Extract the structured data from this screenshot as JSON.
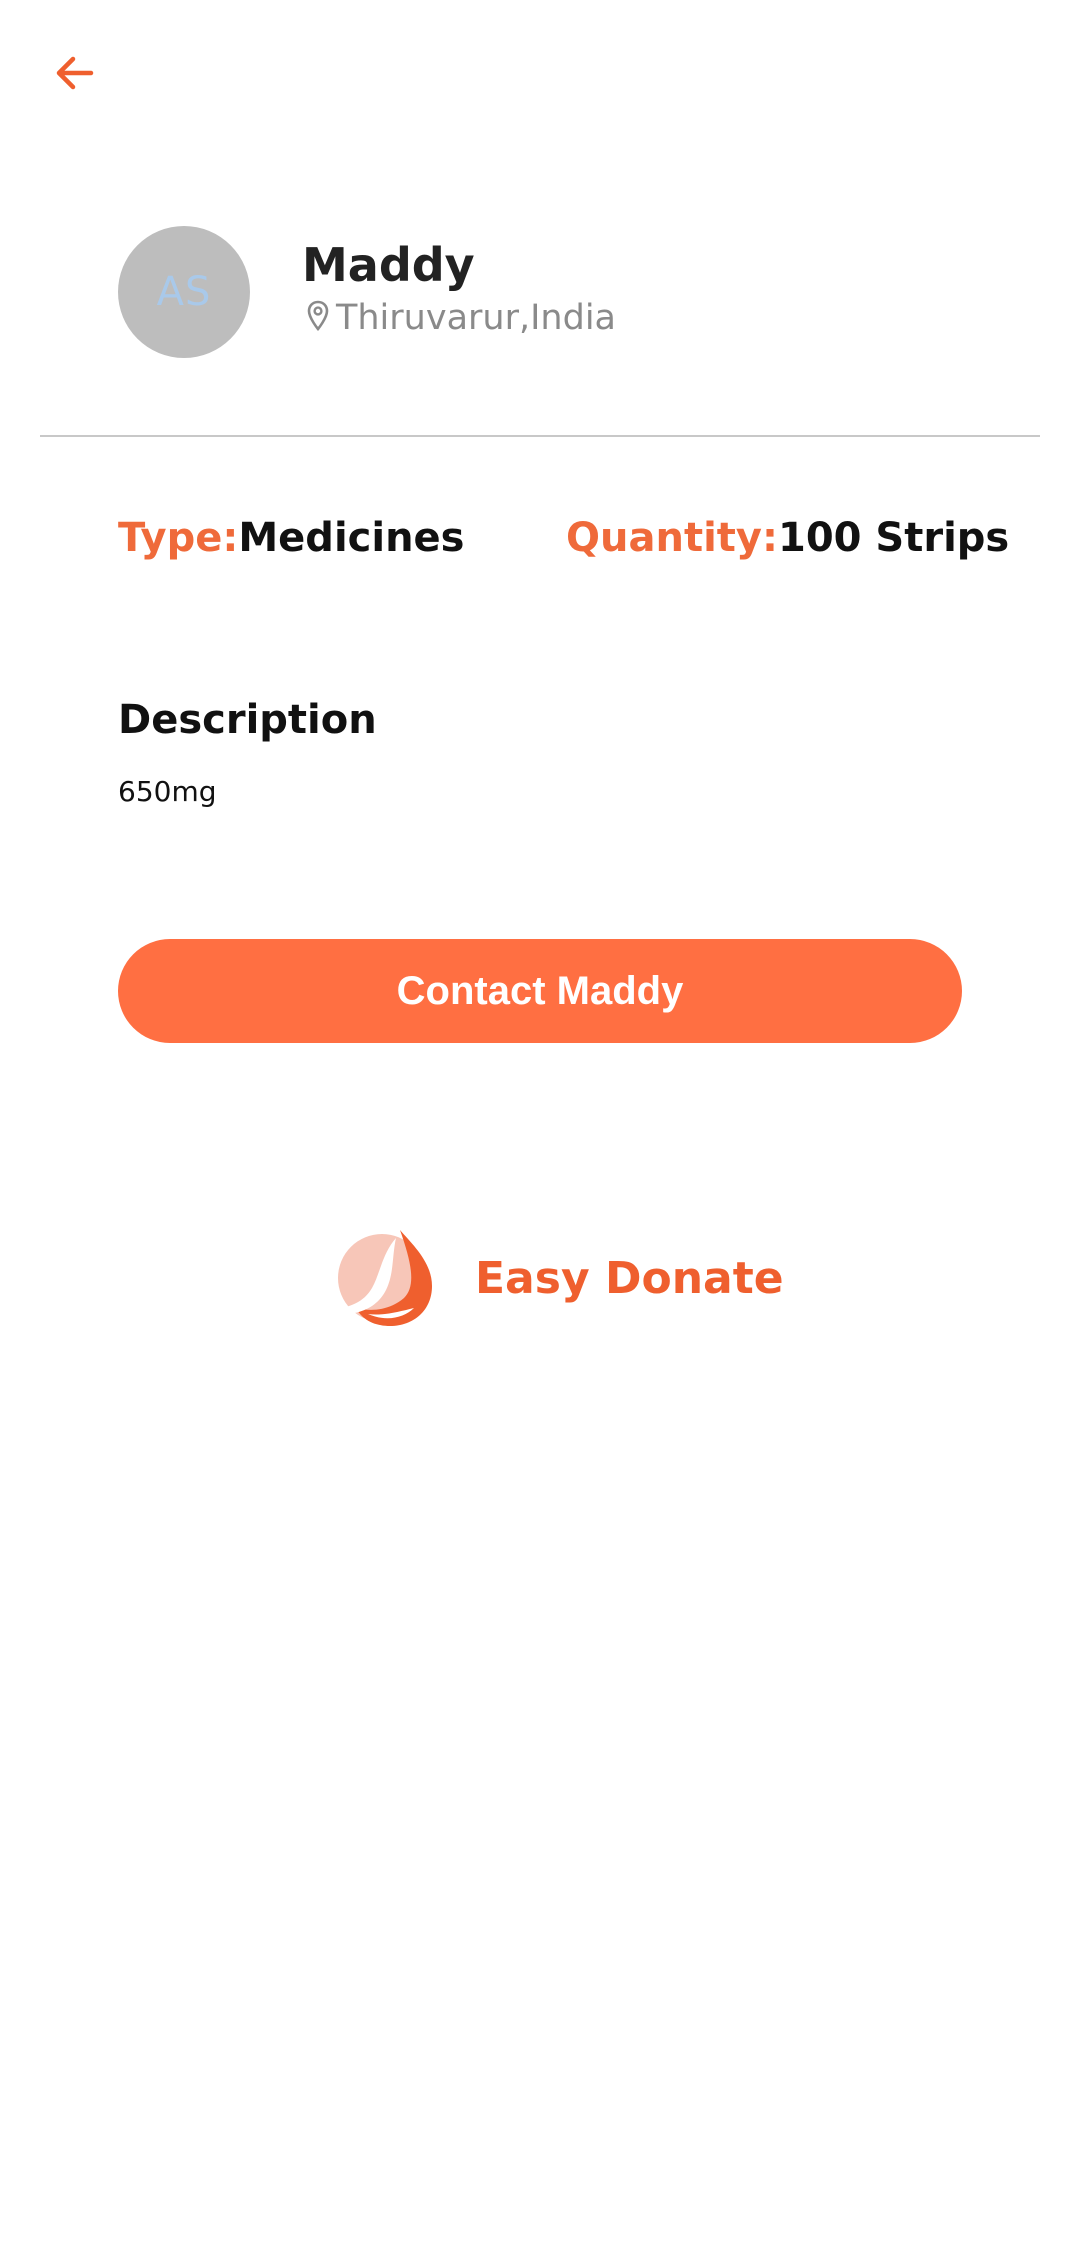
{
  "header": {
    "back_icon": "arrow-left-icon"
  },
  "profile": {
    "avatar_initials": "AS",
    "name": "Maddy",
    "location_icon": "map-pin-icon",
    "location": "Thiruvarur,India"
  },
  "details": {
    "type_label": "Type:",
    "type_value": "Medicines",
    "quantity_label": "Quantity:",
    "quantity_value": "100 Strips"
  },
  "description": {
    "heading": "Description",
    "text": "650mg"
  },
  "actions": {
    "contact_label": "Contact Maddy"
  },
  "brand": {
    "logo_icon": "bird-flame-logo-icon",
    "name": "Easy Donate"
  },
  "colors": {
    "accent": "#ff6f42",
    "accent_text": "#ef6a3a",
    "avatar_bg": "#bdbdbd",
    "avatar_text": "#a9c9ea"
  }
}
